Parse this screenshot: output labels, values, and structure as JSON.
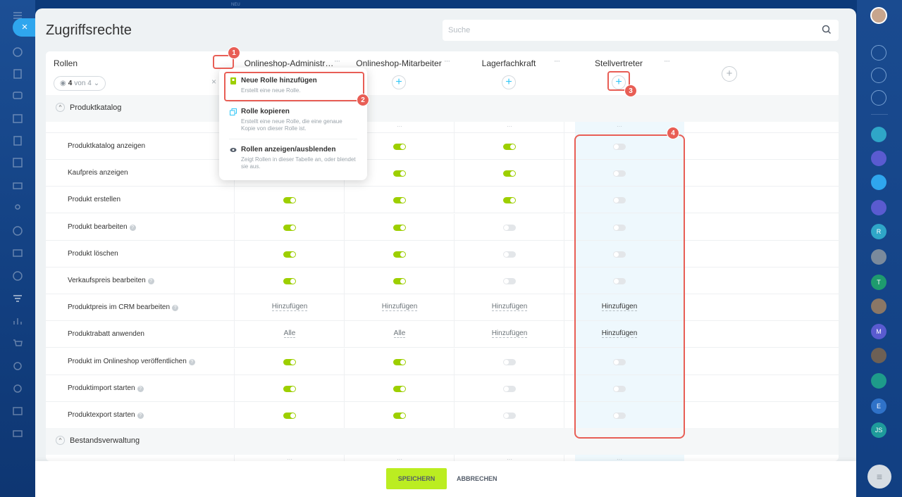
{
  "window": {
    "title": "Zugriffsrechte",
    "top_hint": "NEU",
    "close_glyph": "×"
  },
  "search": {
    "placeholder": "Suche"
  },
  "roles_header": {
    "label": "Rollen",
    "count_value": "4",
    "count_text": "von 4",
    "clear_glyph": "×"
  },
  "roles": [
    {
      "name": "Onlineshop-Administr…"
    },
    {
      "name": "Onlineshop-Mitarbeiter"
    },
    {
      "name": "Lagerfachkraft"
    },
    {
      "name": "Stellvertreter"
    }
  ],
  "sections": [
    {
      "label": "Produktkatalog"
    },
    {
      "label": "Bestandsverwaltung"
    }
  ],
  "rows": [
    {
      "label": "Produktkatalog anzeigen",
      "help": false,
      "values": [
        "on",
        "on",
        "on",
        "off"
      ]
    },
    {
      "label": "Kaufpreis anzeigen",
      "help": false,
      "values": [
        "on",
        "on",
        "on",
        "off"
      ]
    },
    {
      "label": "Produkt erstellen",
      "help": false,
      "values": [
        "on",
        "on",
        "on",
        "off"
      ]
    },
    {
      "label": "Produkt bearbeiten",
      "help": true,
      "values": [
        "on",
        "on",
        "off",
        "off"
      ]
    },
    {
      "label": "Produkt löschen",
      "help": false,
      "values": [
        "on",
        "on",
        "off",
        "off"
      ]
    },
    {
      "label": "Verkaufspreis bearbeiten",
      "help": true,
      "values": [
        "on",
        "on",
        "off",
        "off"
      ]
    },
    {
      "label": "Produktpreis im CRM bearbeiten",
      "help": true,
      "values": [
        "Hinzufügen",
        "Hinzufügen",
        "Hinzufügen",
        "Hinzufügen"
      ]
    },
    {
      "label": "Produktrabatt anwenden",
      "help": false,
      "values": [
        "Alle",
        "Alle",
        "Hinzufügen",
        "Hinzufügen"
      ]
    },
    {
      "label": "Produkt im Onlineshop veröffentlichen",
      "help": true,
      "values": [
        "on",
        "on",
        "off",
        "off"
      ]
    },
    {
      "label": "Produktimport starten",
      "help": true,
      "values": [
        "on",
        "on",
        "off",
        "off"
      ]
    },
    {
      "label": "Produktexport starten",
      "help": true,
      "values": [
        "on",
        "on",
        "off",
        "off"
      ]
    }
  ],
  "dots_label": "···",
  "context_menu": {
    "items": [
      {
        "title": "Neue Rolle hinzufügen",
        "desc": "Erstellt eine neue Rolle."
      },
      {
        "title": "Rolle kopieren",
        "desc": "Erstellt eine neue Rolle, die eine genaue Kopie von dieser Rolle ist."
      },
      {
        "title": "Rollen anzeigen/ausblenden",
        "desc": "Zeigt Rollen in dieser Tabelle an, oder blendet sie aus."
      }
    ]
  },
  "callouts": [
    "1",
    "2",
    "3",
    "4"
  ],
  "footer": {
    "save_label": "SPEICHERN",
    "cancel_label": "ABBRECHEN"
  },
  "right_bar": {
    "letters": [
      "R",
      "T",
      "M",
      "E",
      "JS"
    ]
  },
  "colors": {
    "accent": "#2fc6f6",
    "toggle_on": "#9dcf00",
    "save": "#bbed21",
    "callout": "#e85e55",
    "highlight_bg": "#e9f6fd"
  }
}
